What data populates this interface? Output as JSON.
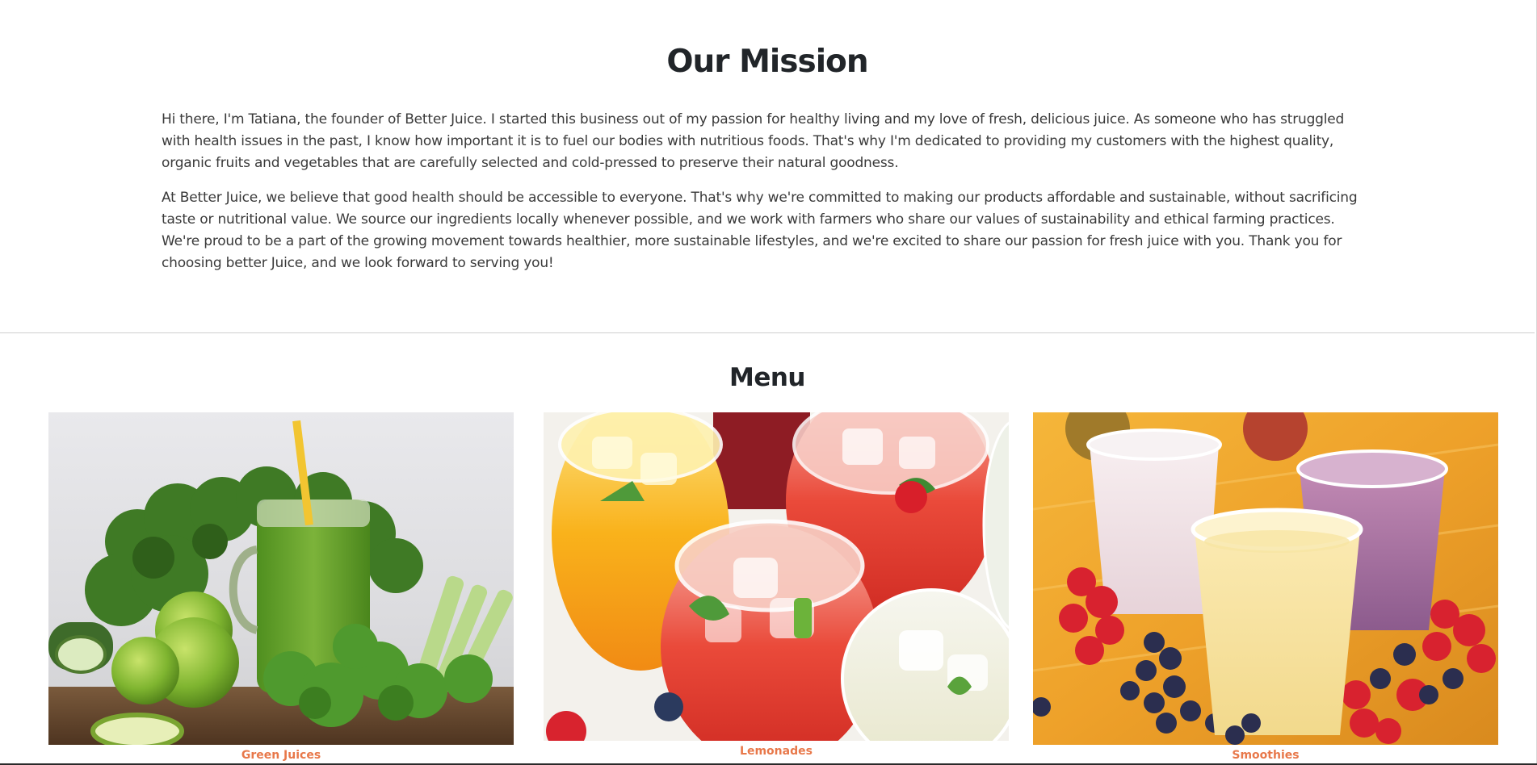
{
  "mission": {
    "title": "Our Mission",
    "paragraphs": [
      "Hi there, I'm Tatiana, the founder of Better Juice. I started this business out of my passion for healthy living and my love of fresh, delicious juice. As someone who has struggled with health issues in the past, I know how important it is to fuel our bodies with nutritious foods. That's why I'm dedicated to providing my customers with the highest quality, organic fruits and vegetables that are carefully selected and cold-pressed to preserve their natural goodness.",
      "At Better Juice, we believe that good health should be accessible to everyone. That's why we're committed to making our products affordable and sustainable, without sacrificing taste or nutritional value. We source our ingredients locally whenever possible, and we work with farmers who share our values of sustainability and ethical farming practices. We're proud to be a part of the growing movement towards healthier, more sustainable lifestyles, and we're excited to share our passion for fresh juice with you. Thank you for choosing better Juice, and we look forward to serving you!"
    ]
  },
  "menu": {
    "title": "Menu",
    "items": [
      {
        "label": "Green Juices",
        "image": "green-juice-photo"
      },
      {
        "label": "Lemonades",
        "image": "lemonade-photo"
      },
      {
        "label": "Smoothies",
        "image": "smoothie-photo"
      }
    ]
  },
  "colors": {
    "heading": "#212529",
    "body_text": "#3a3a3a",
    "caption": "#e8784a",
    "divider": "#cfcfcf"
  }
}
